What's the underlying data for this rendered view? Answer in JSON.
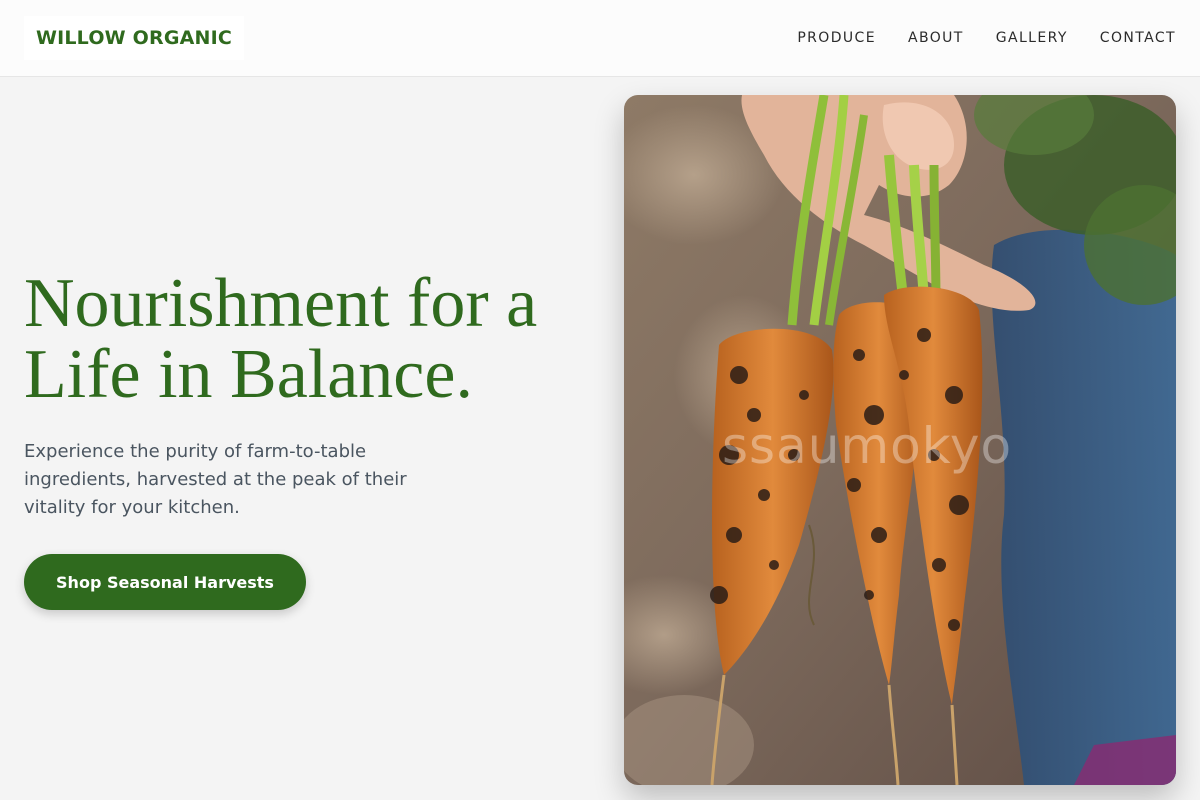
{
  "header": {
    "logo": "WILLOW ORGANIC",
    "nav": [
      "PRODUCE",
      "ABOUT",
      "GALLERY",
      "CONTACT"
    ]
  },
  "hero": {
    "title_line1": "Nourishment for a",
    "title_line2": "Life in Balance.",
    "subtitle": "Experience the purity of farm-to-table ingredients, harvested at the peak of their vitality for your kitchen.",
    "cta_label": "Shop Seasonal Harvests",
    "image_watermark": "ssaumokyo"
  },
  "colors": {
    "brand_green": "#2f6a1e",
    "background": "#f4f4f4",
    "header_bg": "#fcfcfc"
  }
}
